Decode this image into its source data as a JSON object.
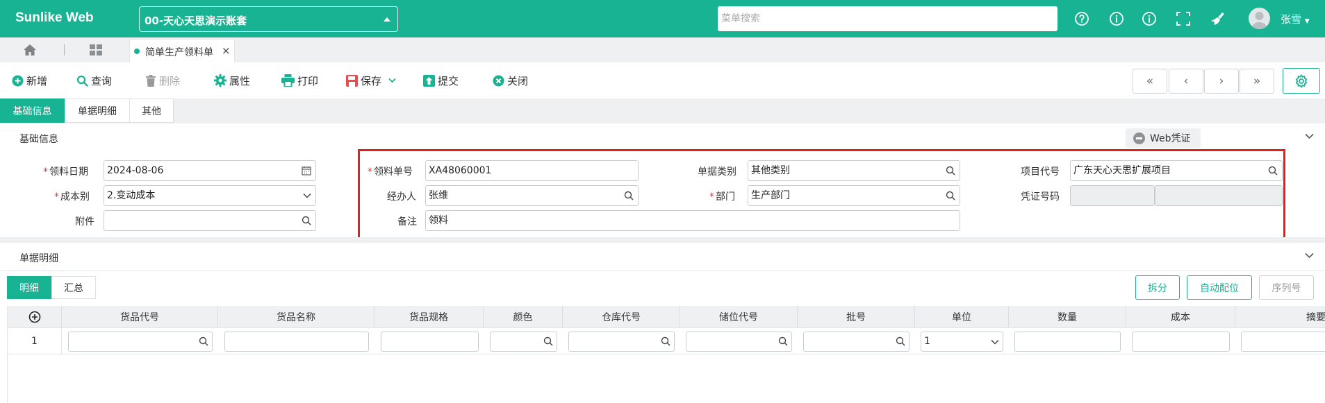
{
  "app": {
    "title": "Sunlike Web",
    "account": "00-天心天思演示账套"
  },
  "topbar": {
    "menu_search_placeholder": "菜单搜索",
    "user": "张雪"
  },
  "tabs": [
    {
      "label": "简单生产领料单"
    }
  ],
  "toolbar": {
    "add": "新增",
    "query": "查询",
    "delete": "删除",
    "properties": "属性",
    "print": "打印",
    "save": "保存",
    "submit": "提交",
    "close": "关闭"
  },
  "section_tabs": [
    "基础信息",
    "单据明细",
    "其他"
  ],
  "basic_section": {
    "title": "基础信息",
    "web_voucher": "Web凭证"
  },
  "form": {
    "issue_date": {
      "label": "领料日期",
      "value": "2024-08-06"
    },
    "cost_type": {
      "label": "成本别",
      "value": "2.变动成本"
    },
    "attachment": {
      "label": "附件",
      "value": ""
    },
    "issue_no": {
      "label": "领料单号",
      "value": "XA48060001"
    },
    "handler": {
      "label": "经办人",
      "value": "张维"
    },
    "remark": {
      "label": "备注",
      "value": "领料"
    },
    "doc_category": {
      "label": "单据类别",
      "value": "其他类别"
    },
    "department": {
      "label": "部门",
      "value": "生产部门"
    },
    "project_code": {
      "label": "项目代号",
      "value": "广东天心天思扩展项目"
    },
    "voucher_no": {
      "label": "凭证号码",
      "value": ""
    }
  },
  "detail_section": {
    "title": "单据明细"
  },
  "detail_tabs": [
    "明细",
    "汇总"
  ],
  "detail_buttons": {
    "split": "拆分",
    "auto_locate": "自动配位",
    "serial": "序列号"
  },
  "grid": {
    "columns": [
      "货品代号",
      "货品名称",
      "货品规格",
      "颜色",
      "仓库代号",
      "储位代号",
      "批号",
      "单位",
      "数量",
      "成本",
      "摘要"
    ],
    "rows": [
      {
        "no": "1",
        "unit": "1"
      }
    ]
  },
  "colors": {
    "accent": "#17b392",
    "highlight": "#e4201b"
  }
}
